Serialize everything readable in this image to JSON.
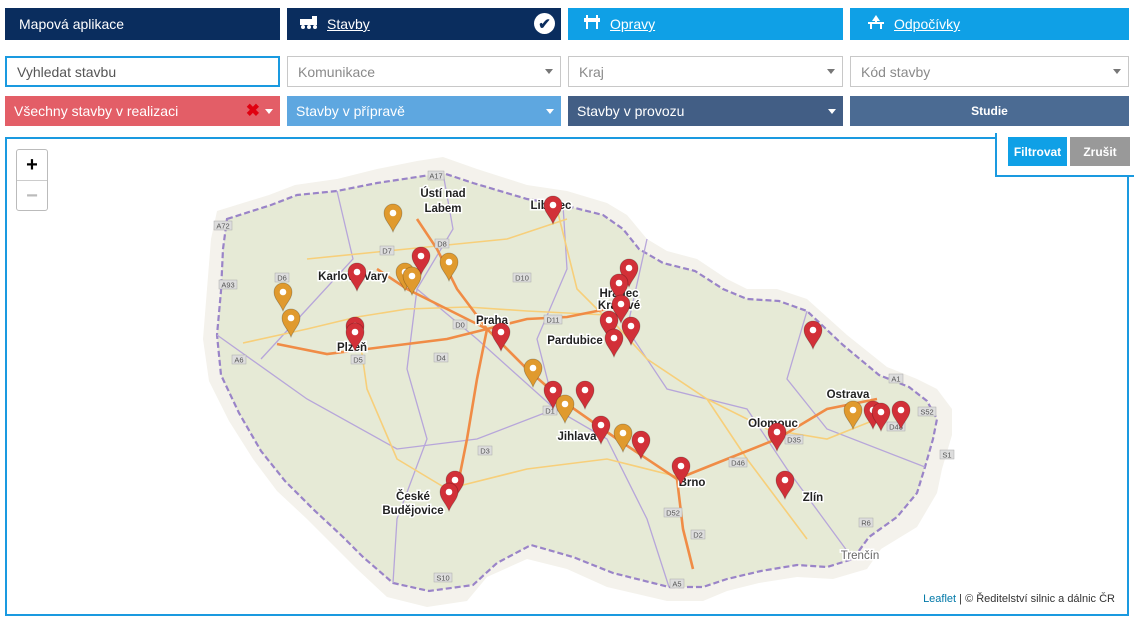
{
  "tabs": {
    "app": "Mapová aplikace",
    "stavby": "Stavby",
    "opravy": "Opravy",
    "odpocivky": "Odpočívky"
  },
  "fields": {
    "search_placeholder": "Vyhledat stavbu",
    "komunikace": "Komunikace",
    "kraj": "Kraj",
    "kod": "Kód stavby"
  },
  "filters": {
    "realizace": "Všechny stavby v realizaci",
    "priprava": "Stavby v přípravě",
    "provoz": "Stavby v provozu",
    "studie": "Studie"
  },
  "buttons": {
    "filtrovat": "Filtrovat",
    "zrusit": "Zrušit"
  },
  "zoom": {
    "in": "+",
    "out": "−"
  },
  "attribution": {
    "leaflet": "Leaflet",
    "text": " | © Ředitelství silnic a dálnic ČR"
  },
  "colors": {
    "navy": "#0a2d5e",
    "sky": "#0fa0e6",
    "red_marker": "#d23038",
    "orange_marker": "#e09a2e"
  },
  "map": {
    "cities": [
      "Ústí nad",
      "Labem",
      "Liberec",
      "Karlovy Vary",
      "Hradec",
      "Králové",
      "Praha",
      "Pardubice",
      "Plzeň",
      "Jihlava",
      "Olomouc",
      "Ostrava",
      "Brno",
      "Zlín",
      "České",
      "Budějovice",
      "Trenčín"
    ],
    "roads": [
      "A17",
      "A72",
      "A93",
      "A6",
      "D8",
      "D7",
      "D6",
      "D10",
      "D11",
      "D0",
      "D5",
      "D4",
      "D3",
      "D1",
      "D2",
      "D52",
      "D35",
      "D46",
      "D48",
      "S52",
      "S1",
      "A1",
      "R6",
      "S10",
      "A5"
    ]
  }
}
